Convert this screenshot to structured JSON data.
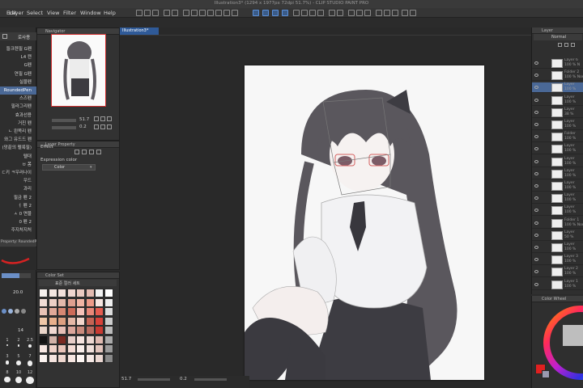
{
  "window": {
    "title": "Illustration3* (1294 x 1977px 72dpi 51.7%) - CLIP STUDIO PAINT PRO"
  },
  "menu": {
    "items": [
      "Edit",
      "Layer",
      "Select",
      "View",
      "Filter",
      "Window",
      "Help"
    ]
  },
  "tool_property": {
    "search_label": "로사용",
    "items": [
      {
        "label": "들크렌필 G펜",
        "selected": false
      },
      {
        "label": "L4 캔",
        "selected": false
      },
      {
        "label": "G펜",
        "selected": false
      },
      {
        "label": "연필 G펜",
        "selected": false
      },
      {
        "label": "실물펜",
        "selected": false
      },
      {
        "label": "RoundedPen",
        "selected": true
      },
      {
        "label": "스즈펜",
        "selected": false
      },
      {
        "label": "필라그리펜",
        "selected": false
      },
      {
        "label": "효과선용",
        "selected": false
      },
      {
        "label": "거친 펜",
        "selected": false
      },
      {
        "label": "ㄴ 왼쪽리 펜",
        "selected": false
      },
      {
        "label": "와그 유드드 펜",
        "selected": false
      },
      {
        "label": "(망끝의 펠룩필)",
        "selected": false
      },
      {
        "label": "텔대",
        "selected": false
      },
      {
        "label": "ㅂ 폼",
        "selected": false
      },
      {
        "label": "ㄷ키 ㅋ우러나이",
        "selected": false
      },
      {
        "label": "우드",
        "selected": false
      },
      {
        "label": "과리",
        "selected": false
      },
      {
        "label": "필금 펜 2",
        "selected": false
      },
      {
        "label": "ㅓ 펜 2",
        "selected": false
      },
      {
        "label": "ㅅ 0 면물",
        "selected": false
      },
      {
        "label": "0 펜 2",
        "selected": false
      },
      {
        "label": "주지처지처",
        "selected": false
      }
    ],
    "property_label": "Property: RoundedPen",
    "brush_size_value": "20.0",
    "brush_size_value2": "14",
    "size_presets": [
      "1",
      "2",
      "2.5",
      "3",
      "5",
      "7",
      "8",
      "10",
      "12"
    ]
  },
  "navigator": {
    "tab_label": "Navigator",
    "zoom": "51.7",
    "rotate": "0.2"
  },
  "layer_property": {
    "tab_label": "Layer Property",
    "effect_label": "Effect",
    "expression_color_label": "Expression color",
    "expression_color_value": "Color"
  },
  "color_set": {
    "tab_label": "Color Set",
    "set_name": "표준 컬러 세트",
    "swatches": [
      "#f6f1ee",
      "#f4e7e2",
      "#f3e1dc",
      "#efd6d0",
      "#e9c9c0",
      "#e3bbb1",
      "#f2f2f2",
      "#ffffff",
      "#f1ddd6",
      "#ecd0c6",
      "#e4b9ab",
      "#de9f8f",
      "#f0b4a4",
      "#ec9a88",
      "#f6e6e1",
      "#eeeeee",
      "#e8c3b6",
      "#e0a998",
      "#d78873",
      "#cc6b59",
      "#f5c1b8",
      "#e88778",
      "#e45c50",
      "#dddddd",
      "#f0c8a8",
      "#e8b08c",
      "#dda081",
      "#e5b8a7",
      "#f2d6cc",
      "#c46354",
      "#d8423a",
      "#cccccc",
      "#ead5c9",
      "#f1d9d2",
      "#e6bfb6",
      "#dba69b",
      "#c98a7c",
      "#b86a5e",
      "#c93a32",
      "#bbbbbb",
      "#141414",
      "#d2b2a8",
      "#7a2a22",
      "#e7cec8",
      "#f5e3de",
      "#ecd7d1",
      "#dfb9b0",
      "#aaaaaa",
      "#f8e8e3",
      "#efd2c9",
      "#e9c4b9",
      "#f4dcd5",
      "#f9eeea",
      "#f0e0db",
      "#e1c4bc",
      "#999999",
      "#fbf3f0",
      "#f4e4df",
      "#eed7cf",
      "#f7e7e2",
      "#fdf6f3",
      "#f6eae6",
      "#ebd8d2",
      "#888888"
    ]
  },
  "canvas": {
    "tab_label": "Illustration3*"
  },
  "status": {
    "zoom": "51.7",
    "angle": "0.2"
  },
  "layer_panel": {
    "tab_label": "Layer",
    "blend_mode": "Normal",
    "layers": [
      {
        "name": "Layer 6",
        "percent": "100 % N",
        "selected": false
      },
      {
        "name": "Folder 2",
        "percent": "100 % Normal",
        "selected": false
      },
      {
        "name": "Layer",
        "percent": "100 %",
        "selected": true
      },
      {
        "name": "Layer",
        "percent": "100 %",
        "selected": false
      },
      {
        "name": "Layer",
        "percent": "38 %",
        "selected": false
      },
      {
        "name": "Layer",
        "percent": "100 %",
        "selected": false
      },
      {
        "name": "Folder",
        "percent": "100 %",
        "selected": false
      },
      {
        "name": "Layer",
        "percent": "100 %",
        "selected": false
      },
      {
        "name": "Layer",
        "percent": "100 %",
        "selected": false
      },
      {
        "name": "Layer",
        "percent": "100 %",
        "selected": false
      },
      {
        "name": "Layer",
        "percent": "100 %",
        "selected": false
      },
      {
        "name": "Layer",
        "percent": "100 %",
        "selected": false
      },
      {
        "name": "Layer",
        "percent": "100 %",
        "selected": false
      },
      {
        "name": "Folder 1",
        "percent": "100 % Normal",
        "selected": false
      },
      {
        "name": "Layer",
        "percent": "50 %",
        "selected": false
      },
      {
        "name": "Layer",
        "percent": "100 %",
        "selected": false
      },
      {
        "name": "Layer 3",
        "percent": "100 %",
        "selected": false
      },
      {
        "name": "Layer 2",
        "percent": "100 %",
        "selected": false
      },
      {
        "name": "Layer 1",
        "percent": "100 %",
        "selected": false
      }
    ]
  },
  "color_wheel": {
    "tab_label": "Color Wheel",
    "main_color": "#e02020"
  },
  "colors": {
    "accent": "#4a6896",
    "canvas_tab": "#2f5a98"
  }
}
